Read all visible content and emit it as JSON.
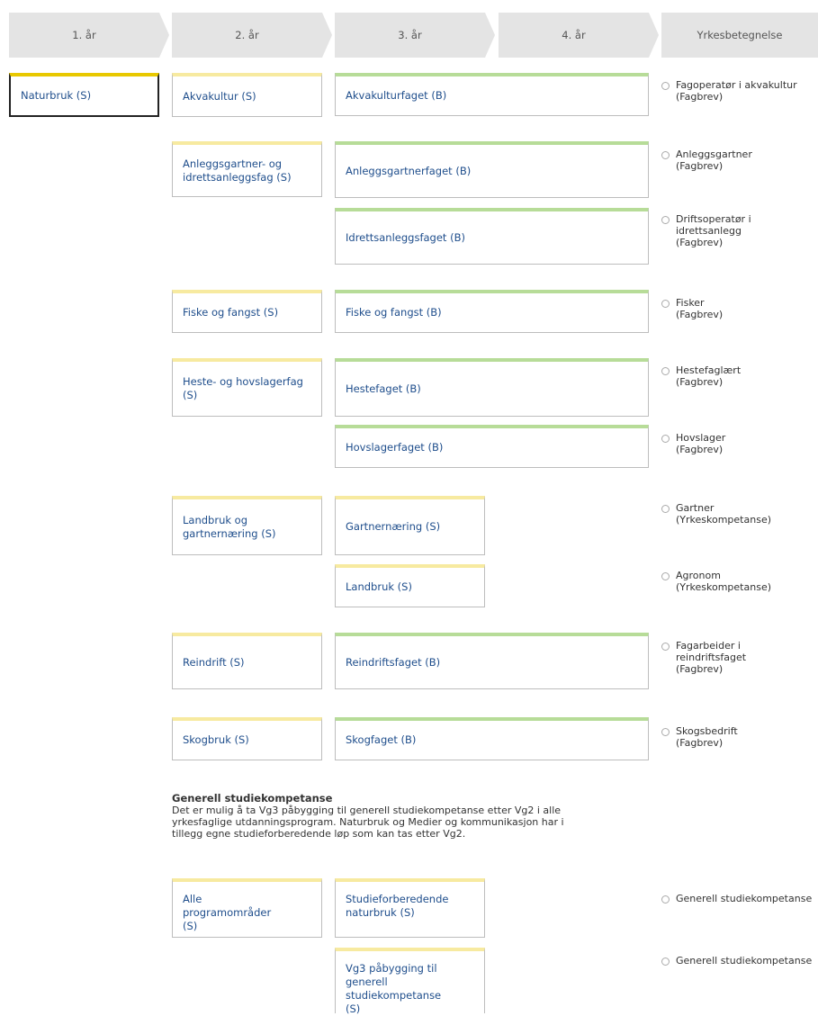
{
  "headers": [
    "1. år",
    "2. år",
    "3. år",
    "4. år",
    "Yrkesbetegnelse"
  ],
  "year1": {
    "label": "Naturbruk (S)"
  },
  "year2": [
    "Akvakultur (S)",
    "Anleggsgartner- og idrettsanleggsfag (S)",
    "Fiske og fangst (S)",
    "Heste- og hovslagerfag (S)",
    "Landbruk og gartnernæring (S)",
    "Reindrift (S)",
    "Skogbruk (S)"
  ],
  "year3": [
    "Akvakulturfaget (B)",
    "Anleggsgartnerfaget (B)",
    "Idrettsanleggsfaget (B)",
    "Fiske og fangst (B)",
    "Hestefaget (B)",
    "Hovslagerfaget (B)",
    "Gartnernæring (S)",
    "Landbruk (S)",
    "Reindriftsfaget (B)",
    "Skogfaget (B)"
  ],
  "occupations": [
    {
      "title": "Fagoperatør i akvakultur",
      "type": "(Fagbrev)"
    },
    {
      "title": "Anleggsgartner",
      "type": "(Fagbrev)"
    },
    {
      "title": "Driftsoperatør i idrettsanlegg",
      "type": "(Fagbrev)"
    },
    {
      "title": "Fisker",
      "type": "(Fagbrev)"
    },
    {
      "title": "Hestefaglært",
      "type": "(Fagbrev)"
    },
    {
      "title": "Hovslager",
      "type": "(Fagbrev)"
    },
    {
      "title": "Gartner",
      "type": "(Yrkeskompetanse)"
    },
    {
      "title": "Agronom",
      "type": "(Yrkeskompetanse)"
    },
    {
      "title": "Fagarbeider i reindriftsfaget",
      "type": "(Fagbrev)"
    },
    {
      "title": "Skogsbedrift",
      "type": "(Fagbrev)"
    }
  ],
  "general": {
    "title": "Generell studiekompetanse",
    "text": "Det er mulig å ta Vg3 påbygging til generell studiekompetanse etter Vg2 i alle yrkesfaglige utdanningsprogram. Naturbruk og Medier og kommunikasjon har i tillegg egne studieforberedende løp som kan tas etter Vg2.",
    "year2": [
      "Alle programområder (S)"
    ],
    "year3": [
      "Studieforberedende naturbruk (S)",
      "Vg3 påbygging til generell studiekompetanse (S)"
    ],
    "occupations": [
      "Generell studiekompetanse",
      "Generell studiekompetanse"
    ]
  }
}
